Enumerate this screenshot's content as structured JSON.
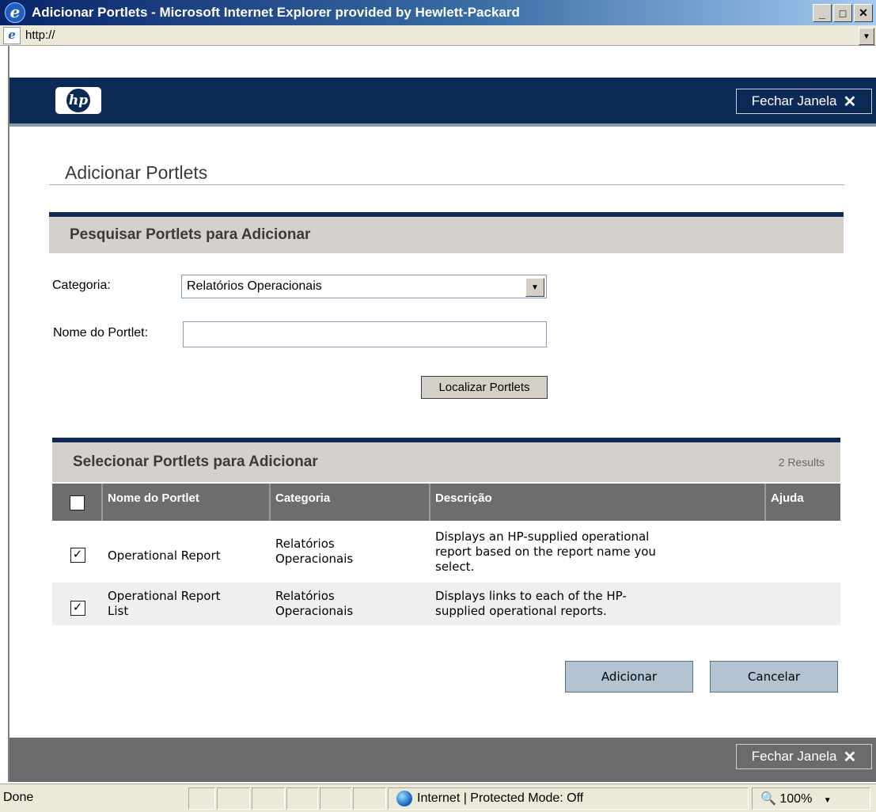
{
  "window": {
    "title": "Adicionar Portlets - Microsoft Internet Explorer provided by Hewlett-Packard",
    "address": "http://",
    "icon": "ie-icon"
  },
  "header": {
    "logo": "hp",
    "close_label": "Fechar Janela",
    "close_icon": "✕"
  },
  "page_title": "Adicionar Portlets",
  "search": {
    "section_title": "Pesquisar Portlets para Adicionar",
    "category_label": "Categoria:",
    "category_value": "Relatórios Operacionais",
    "name_label": "Nome do Portlet:",
    "name_value": "",
    "find_button": "Localizar Portlets"
  },
  "results": {
    "section_title": "Selecionar Portlets para Adicionar",
    "count": "2 Results",
    "columns": [
      "Nome do Portlet",
      "Categoria",
      "Descrição",
      "Ajuda"
    ],
    "rows": [
      {
        "checked": true,
        "name": "Operational Report",
        "category_line1": "Relatórios",
        "category_line2": "Operacionais",
        "desc_line1": "Displays an HP-supplied operational",
        "desc_line2": "report based on the report name you",
        "desc_line3": "select."
      },
      {
        "checked": true,
        "name_line1": "Operational Report",
        "name_line2": "List",
        "category_line1": "Relatórios",
        "category_line2": "Operacionais",
        "desc_line1": "Displays links to each of the HP-",
        "desc_line2": "supplied operational reports."
      }
    ]
  },
  "actions": {
    "add": "Adicionar",
    "cancel": "Cancelar"
  },
  "footer": {
    "close_label": "Fechar Janela"
  },
  "status": {
    "left": "Done",
    "zone": "Internet | Protected Mode: Off",
    "zoom": "100%"
  },
  "colors": {
    "header_navy": "#0d2a57",
    "section_bar": "#d4d0cc",
    "table_header": "#6d6d6d",
    "action_button": "#b2c3d2"
  }
}
